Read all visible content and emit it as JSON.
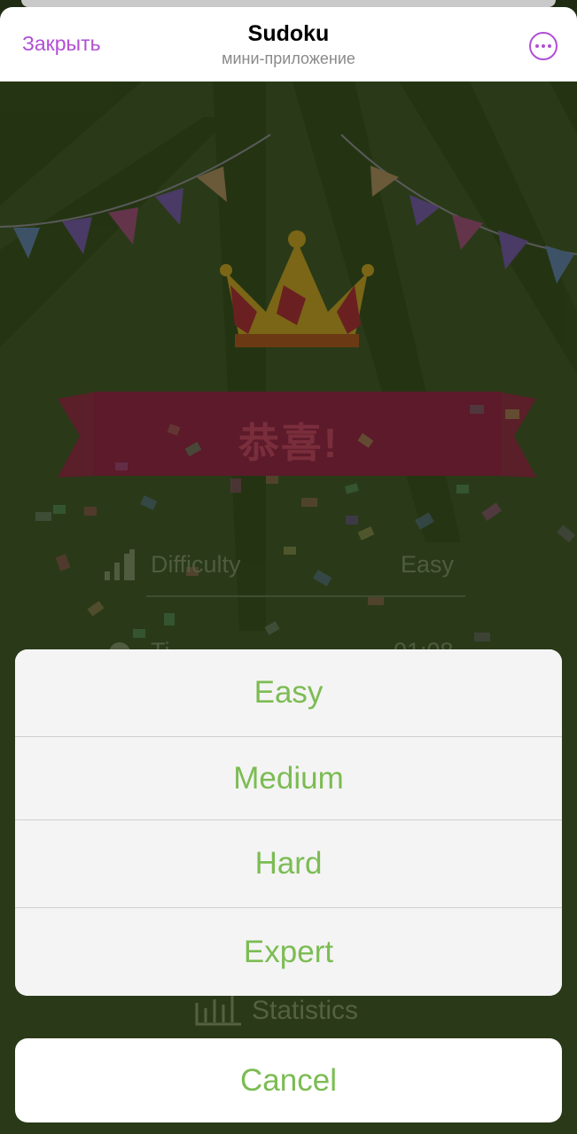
{
  "header": {
    "close_label": "Закрыть",
    "title": "Sudoku",
    "subtitle": "мини-приложение",
    "more_icon": "more-dots-icon"
  },
  "game": {
    "banner_text": "恭喜!",
    "difficulty_label": "Difficulty",
    "difficulty_value": "Easy",
    "time_label": "Ti",
    "time_value": "01:08",
    "statistics_label": "Statistics"
  },
  "sheet": {
    "options": [
      "Easy",
      "Medium",
      "Hard",
      "Expert"
    ],
    "cancel_label": "Cancel",
    "accent_color": "#7cbc53"
  },
  "colors": {
    "header_accent": "#b24ed6",
    "background": "#2a3a18"
  }
}
